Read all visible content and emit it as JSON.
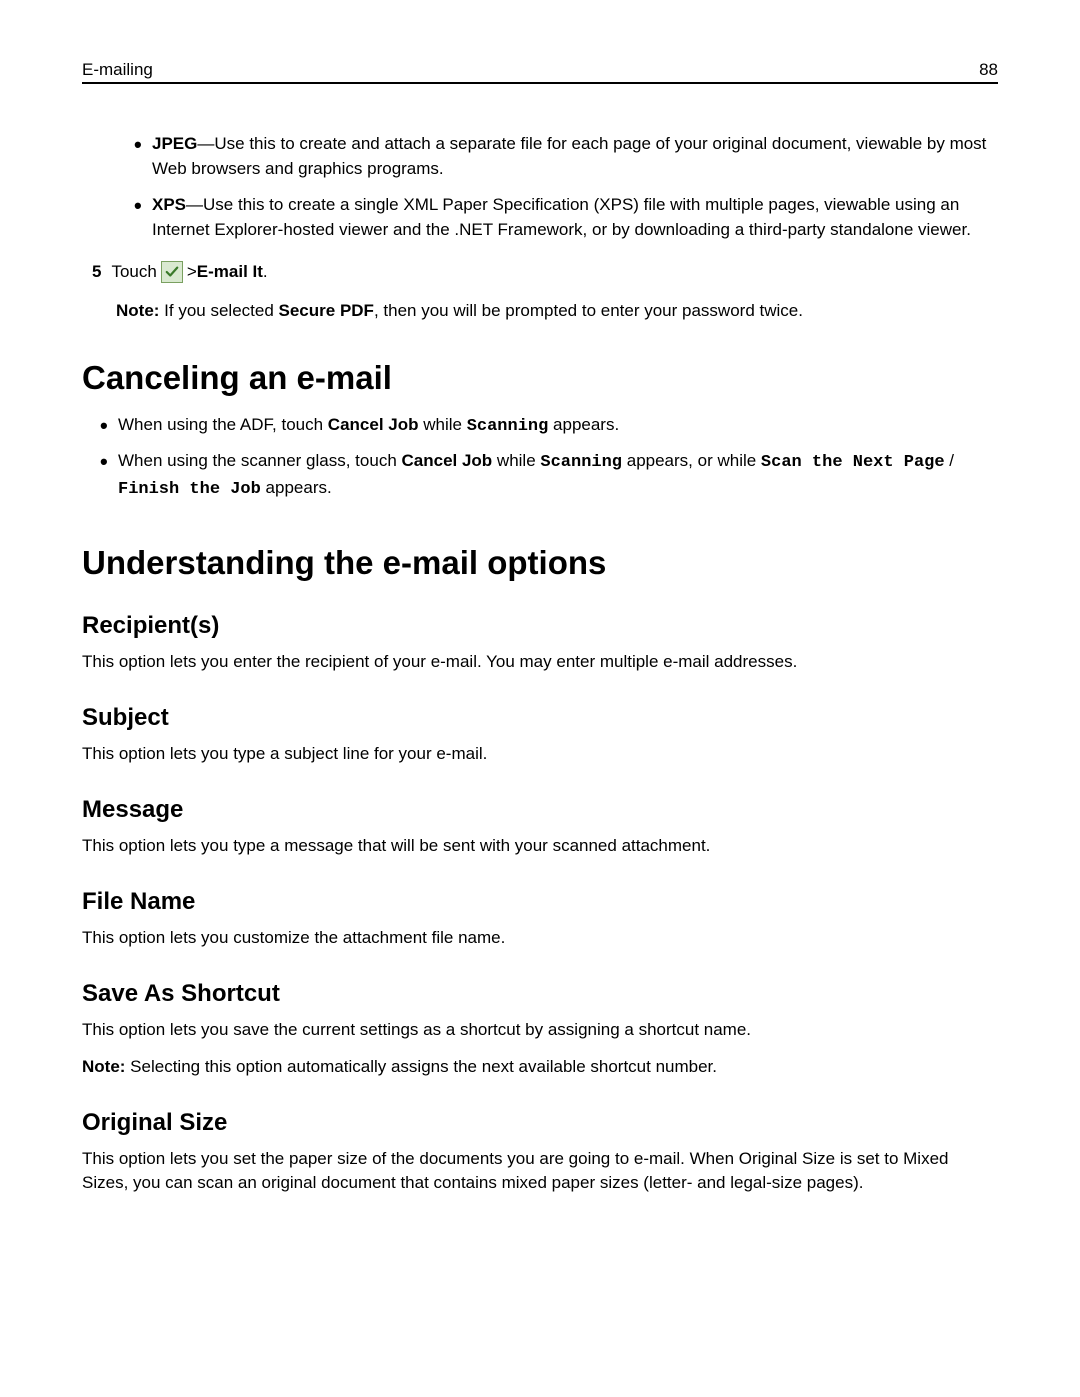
{
  "header": {
    "section": "E-mailing",
    "page": "88"
  },
  "formats": {
    "jpeg": {
      "label": "JPEG",
      "desc": "—Use this to create and attach a separate file for each page of your original document, viewable by most Web browsers and graphics programs."
    },
    "xps": {
      "label": "XPS",
      "desc": "—Use this to create a single XML Paper Specification (XPS) file with multiple pages, viewable using an Internet Explorer-hosted viewer and the .NET Framework, or by downloading a third-party standalone viewer."
    }
  },
  "step5": {
    "num": "5",
    "touch": "Touch ",
    "arrow": " > ",
    "emailit": "E-mail It",
    "period": "."
  },
  "note1": {
    "label": "Note: ",
    "pre": "If you selected ",
    "secure": "Secure PDF",
    "post": ", then you will be prompted to enter your password twice."
  },
  "cancel": {
    "heading": "Canceling an e-mail",
    "b1": {
      "pre": "When using the ADF, touch ",
      "cj": "Cancel Job",
      "mid": " while ",
      "scanning": "Scanning",
      "post": " appears."
    },
    "b2": {
      "pre": "When using the scanner glass, touch ",
      "cj": "Cancel Job",
      "mid1": " while ",
      "scanning": "Scanning",
      "mid2": " appears, or while ",
      "snp": "Scan the Next Page",
      "slash": " / ",
      "ftj": "Finish the Job",
      "post": " appears."
    }
  },
  "options": {
    "heading": "Understanding the e-mail options",
    "recipients": {
      "title": "Recipient(s)",
      "text": "This option lets you enter the recipient of your e-mail. You may enter multiple e-mail addresses."
    },
    "subject": {
      "title": "Subject",
      "text": "This option lets you type a subject line for your e-mail."
    },
    "message": {
      "title": "Message",
      "text": "This option lets you type a message that will be sent with your scanned attachment."
    },
    "filename": {
      "title": "File Name",
      "text": "This option lets you customize the attachment file name."
    },
    "saveas": {
      "title": "Save As Shortcut",
      "text": "This option lets you save the current settings as a shortcut by assigning a shortcut name.",
      "note_label": "Note: ",
      "note_text": "Selecting this option automatically assigns the next available shortcut number."
    },
    "original": {
      "title": "Original Size",
      "text": "This option lets you set the paper size of the documents you are going to e-mail. When Original Size is set to Mixed Sizes, you can scan an original document that contains mixed paper sizes (letter- and legal-size pages)."
    }
  }
}
